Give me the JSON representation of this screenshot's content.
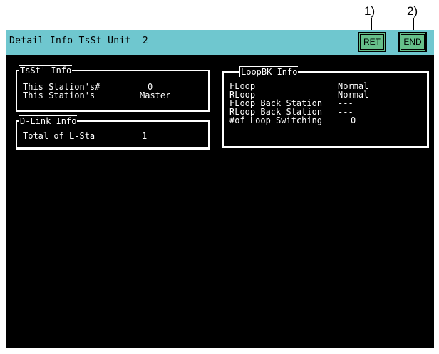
{
  "callouts": [
    "1)",
    "2)"
  ],
  "header": {
    "title": "Detail Info TsSt Unit  2",
    "ret_label": "RET",
    "end_label": "END"
  },
  "tsst": {
    "title": "TsSt' Info",
    "rows": [
      {
        "label": "This Station's#",
        "value": "0"
      },
      {
        "label": "This Station's",
        "value": "Master"
      }
    ]
  },
  "dlink": {
    "title": "D-Link Info",
    "rows": [
      {
        "label": "Total of L-Sta",
        "value": "1"
      }
    ]
  },
  "loopbk": {
    "title": "LoopBK Info",
    "rows": [
      {
        "label": "FLoop",
        "value": "Normal"
      },
      {
        "label": "RLoop",
        "value": "Normal"
      },
      {
        "label": "FLoop Back Station",
        "value": "---"
      },
      {
        "label": "RLoop Back Station",
        "value": "---"
      },
      {
        "label": "#of Loop Switching",
        "value": "0"
      }
    ]
  },
  "colors": {
    "titlebar": "#6fc7cf",
    "button": "#66c08a",
    "screen": "#000000",
    "text": "#ffffff"
  }
}
